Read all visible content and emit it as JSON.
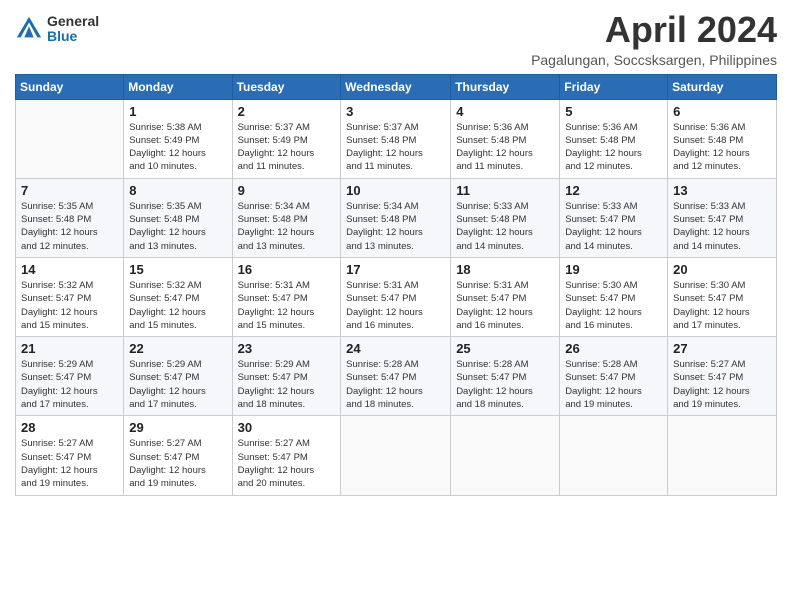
{
  "header": {
    "logo_general": "General",
    "logo_blue": "Blue",
    "title": "April 2024",
    "subtitle": "Pagalungan, Soccsksargen, Philippines"
  },
  "calendar": {
    "days_of_week": [
      "Sunday",
      "Monday",
      "Tuesday",
      "Wednesday",
      "Thursday",
      "Friday",
      "Saturday"
    ],
    "weeks": [
      [
        {
          "day": "",
          "info": ""
        },
        {
          "day": "1",
          "info": "Sunrise: 5:38 AM\nSunset: 5:49 PM\nDaylight: 12 hours\nand 10 minutes."
        },
        {
          "day": "2",
          "info": "Sunrise: 5:37 AM\nSunset: 5:49 PM\nDaylight: 12 hours\nand 11 minutes."
        },
        {
          "day": "3",
          "info": "Sunrise: 5:37 AM\nSunset: 5:48 PM\nDaylight: 12 hours\nand 11 minutes."
        },
        {
          "day": "4",
          "info": "Sunrise: 5:36 AM\nSunset: 5:48 PM\nDaylight: 12 hours\nand 11 minutes."
        },
        {
          "day": "5",
          "info": "Sunrise: 5:36 AM\nSunset: 5:48 PM\nDaylight: 12 hours\nand 12 minutes."
        },
        {
          "day": "6",
          "info": "Sunrise: 5:36 AM\nSunset: 5:48 PM\nDaylight: 12 hours\nand 12 minutes."
        }
      ],
      [
        {
          "day": "7",
          "info": "Sunrise: 5:35 AM\nSunset: 5:48 PM\nDaylight: 12 hours\nand 12 minutes."
        },
        {
          "day": "8",
          "info": "Sunrise: 5:35 AM\nSunset: 5:48 PM\nDaylight: 12 hours\nand 13 minutes."
        },
        {
          "day": "9",
          "info": "Sunrise: 5:34 AM\nSunset: 5:48 PM\nDaylight: 12 hours\nand 13 minutes."
        },
        {
          "day": "10",
          "info": "Sunrise: 5:34 AM\nSunset: 5:48 PM\nDaylight: 12 hours\nand 13 minutes."
        },
        {
          "day": "11",
          "info": "Sunrise: 5:33 AM\nSunset: 5:48 PM\nDaylight: 12 hours\nand 14 minutes."
        },
        {
          "day": "12",
          "info": "Sunrise: 5:33 AM\nSunset: 5:47 PM\nDaylight: 12 hours\nand 14 minutes."
        },
        {
          "day": "13",
          "info": "Sunrise: 5:33 AM\nSunset: 5:47 PM\nDaylight: 12 hours\nand 14 minutes."
        }
      ],
      [
        {
          "day": "14",
          "info": "Sunrise: 5:32 AM\nSunset: 5:47 PM\nDaylight: 12 hours\nand 15 minutes."
        },
        {
          "day": "15",
          "info": "Sunrise: 5:32 AM\nSunset: 5:47 PM\nDaylight: 12 hours\nand 15 minutes."
        },
        {
          "day": "16",
          "info": "Sunrise: 5:31 AM\nSunset: 5:47 PM\nDaylight: 12 hours\nand 15 minutes."
        },
        {
          "day": "17",
          "info": "Sunrise: 5:31 AM\nSunset: 5:47 PM\nDaylight: 12 hours\nand 16 minutes."
        },
        {
          "day": "18",
          "info": "Sunrise: 5:31 AM\nSunset: 5:47 PM\nDaylight: 12 hours\nand 16 minutes."
        },
        {
          "day": "19",
          "info": "Sunrise: 5:30 AM\nSunset: 5:47 PM\nDaylight: 12 hours\nand 16 minutes."
        },
        {
          "day": "20",
          "info": "Sunrise: 5:30 AM\nSunset: 5:47 PM\nDaylight: 12 hours\nand 17 minutes."
        }
      ],
      [
        {
          "day": "21",
          "info": "Sunrise: 5:29 AM\nSunset: 5:47 PM\nDaylight: 12 hours\nand 17 minutes."
        },
        {
          "day": "22",
          "info": "Sunrise: 5:29 AM\nSunset: 5:47 PM\nDaylight: 12 hours\nand 17 minutes."
        },
        {
          "day": "23",
          "info": "Sunrise: 5:29 AM\nSunset: 5:47 PM\nDaylight: 12 hours\nand 18 minutes."
        },
        {
          "day": "24",
          "info": "Sunrise: 5:28 AM\nSunset: 5:47 PM\nDaylight: 12 hours\nand 18 minutes."
        },
        {
          "day": "25",
          "info": "Sunrise: 5:28 AM\nSunset: 5:47 PM\nDaylight: 12 hours\nand 18 minutes."
        },
        {
          "day": "26",
          "info": "Sunrise: 5:28 AM\nSunset: 5:47 PM\nDaylight: 12 hours\nand 19 minutes."
        },
        {
          "day": "27",
          "info": "Sunrise: 5:27 AM\nSunset: 5:47 PM\nDaylight: 12 hours\nand 19 minutes."
        }
      ],
      [
        {
          "day": "28",
          "info": "Sunrise: 5:27 AM\nSunset: 5:47 PM\nDaylight: 12 hours\nand 19 minutes."
        },
        {
          "day": "29",
          "info": "Sunrise: 5:27 AM\nSunset: 5:47 PM\nDaylight: 12 hours\nand 19 minutes."
        },
        {
          "day": "30",
          "info": "Sunrise: 5:27 AM\nSunset: 5:47 PM\nDaylight: 12 hours\nand 20 minutes."
        },
        {
          "day": "",
          "info": ""
        },
        {
          "day": "",
          "info": ""
        },
        {
          "day": "",
          "info": ""
        },
        {
          "day": "",
          "info": ""
        }
      ]
    ]
  }
}
